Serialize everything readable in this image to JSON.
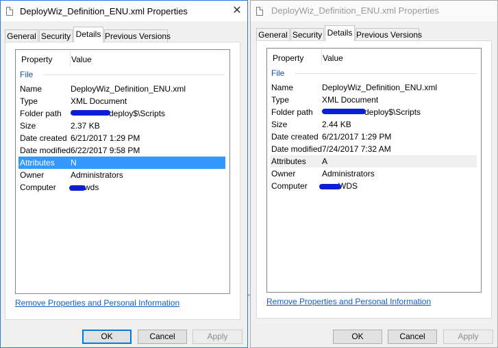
{
  "left": {
    "title": "DeployWiz_Definition_ENU.xml Properties",
    "close": "✕",
    "tabs": [
      "General",
      "Security",
      "Details",
      "Previous Versions"
    ],
    "header": {
      "property": "Property",
      "value": "Value"
    },
    "group": "File",
    "rows": [
      {
        "k": "Name",
        "v": "DeployWiz_Definition_ENU.xml"
      },
      {
        "k": "Type",
        "v": "XML Document"
      },
      {
        "k": "Folder path",
        "v": "deploy$\\Scripts"
      },
      {
        "k": "Size",
        "v": "2.37 KB"
      },
      {
        "k": "Date created",
        "v": "6/21/2017 1:29 PM"
      },
      {
        "k": "Date modified",
        "v": "6/22/2017 9:58 PM"
      },
      {
        "k": "Attributes",
        "v": "N"
      },
      {
        "k": "Owner",
        "v": "Administrators"
      },
      {
        "k": "Computer",
        "v": "wds"
      }
    ],
    "link": "Remove Properties and Personal Information",
    "buttons": {
      "ok": "OK",
      "cancel": "Cancel",
      "apply": "Apply"
    }
  },
  "right": {
    "title": "DeployWiz_Definition_ENU.xml Properties",
    "tabs": [
      "General",
      "Security",
      "Details",
      "Previous Versions"
    ],
    "header": {
      "property": "Property",
      "value": "Value"
    },
    "group": "File",
    "rows": [
      {
        "k": "Name",
        "v": "DeployWiz_Definition_ENU.xml"
      },
      {
        "k": "Type",
        "v": "XML Document"
      },
      {
        "k": "Folder path",
        "v": "deploy$\\Scripts"
      },
      {
        "k": "Size",
        "v": "2.44 KB"
      },
      {
        "k": "Date created",
        "v": "6/21/2017 1:29 PM"
      },
      {
        "k": "Date modified",
        "v": "7/24/2017 7:32 AM"
      },
      {
        "k": "Attributes",
        "v": "A"
      },
      {
        "k": "Owner",
        "v": "Administrators"
      },
      {
        "k": "Computer",
        "v": "WDS"
      }
    ],
    "link": "Remove Properties and Personal Information",
    "buttons": {
      "ok": "OK",
      "cancel": "Cancel",
      "apply": "Apply"
    }
  },
  "colors": {
    "selection": "#3399ff",
    "link": "#0f5fc2",
    "redaction": "#0b1fd6",
    "accent": "#0078d7"
  }
}
